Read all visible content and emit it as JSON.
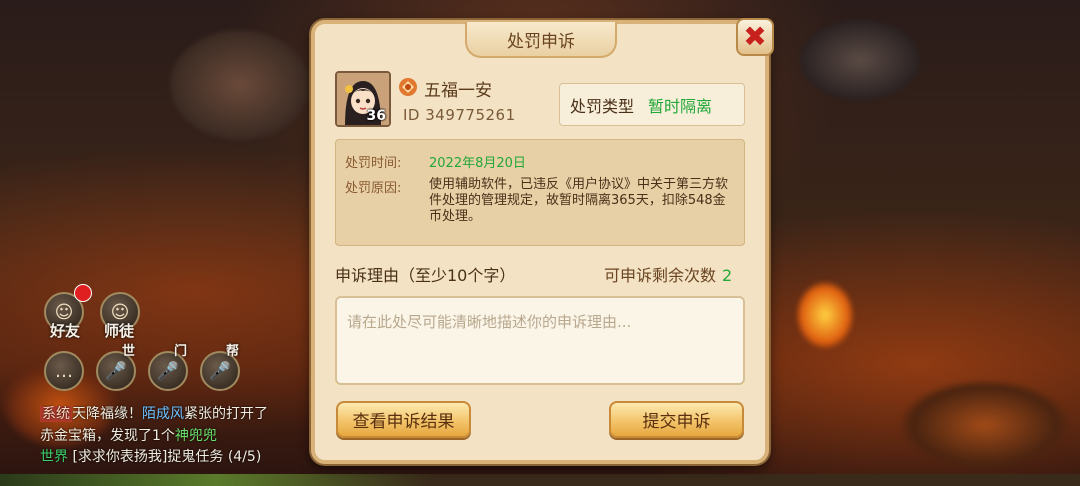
{
  "dialog": {
    "title": "处罚申诉",
    "close_symbol": "✖"
  },
  "player": {
    "name": "五福一安",
    "id": "ID 349775261",
    "level": "36"
  },
  "penalty": {
    "type_label": "处罚类型",
    "type_value": "暂时隔离",
    "time_label": "处罚时间:",
    "time_value": "2022年8月20日",
    "reason_label": "处罚原因:",
    "reason_value": "使用辅助软件，已违反《用户协议》中关于第三方软件处理的管理规定，故暂时隔离365天，扣除548金币处理。"
  },
  "appeal": {
    "reason_title": "申诉理由（至少10个字）",
    "remaining_label": "可申诉剩余次数",
    "remaining_count": "2",
    "placeholder": "请在此处尽可能清晰地描述你的申诉理由..."
  },
  "buttons": {
    "view_result": "查看申诉结果",
    "submit": "提交申诉"
  },
  "hud": {
    "friends_label": "好友",
    "mentor_label": "师徒",
    "voice_world": "世",
    "voice_sect": "门",
    "voice_guild": "帮"
  },
  "chat": {
    "line1_tag": "系统",
    "line1_a": "天降福缘！",
    "line1_name": "陌成风",
    "line1_b": "紧张的打开了",
    "line2_a": "赤金宝箱，发现了1个",
    "line2_item": "神兜兜",
    "line3_tag": "世界",
    "line3_text": "[求求你表扬我]捉鬼任务 (4/5)"
  },
  "colors": {
    "accent_green": "#22a838",
    "close_red": "#c8201c",
    "panel_bg": "#f3e3c4"
  }
}
